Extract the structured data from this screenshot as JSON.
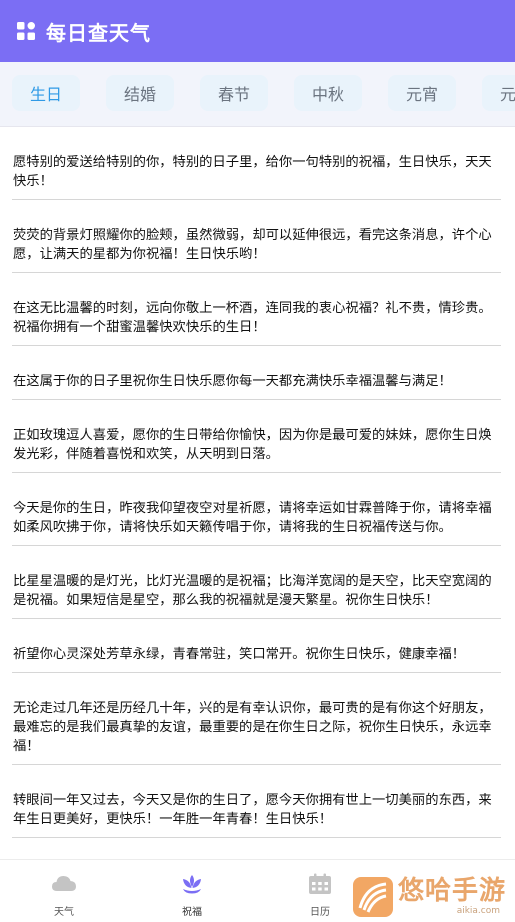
{
  "header": {
    "title": "每日查天气",
    "icon": "grid-icon"
  },
  "tabs": [
    {
      "label": "生日",
      "active": true
    },
    {
      "label": "结婚",
      "active": false
    },
    {
      "label": "春节",
      "active": false
    },
    {
      "label": "中秋",
      "active": false
    },
    {
      "label": "元宵",
      "active": false
    },
    {
      "label": "元旦",
      "active": false
    }
  ],
  "messages": [
    "愿特别的爱送给特别的你，特别的日子里，给你一句特别的祝福，生日快乐，天天快乐！",
    "荧荧的背景灯照耀你的脸颊，虽然微弱，却可以延伸很远，看完这条消息，许个心愿，让满天的星都为你祝福！生日快乐哟！",
    "在这无比温馨的时刻，远向你敬上一杯酒，连同我的衷心祝福？礼不贵，情珍贵。祝福你拥有一个甜蜜温馨快欢快乐的生日！",
    "在这属于你的日子里祝你生日快乐愿你每一天都充满快乐幸福温馨与满足！",
    "正如玫瑰逗人喜爱，愿你的生日带给你愉快，因为你是最可爱的妹妹，愿你生日焕发光彩，伴随着喜悦和欢笑，从天明到日落。",
    "今天是你的生日，昨夜我仰望夜空对星祈愿，请将幸运如甘霖普降于你，请将幸福如柔风吹拂于你，请将快乐如天籁传唱于你，请将我的生日祝福传送与你。",
    "比星星温暖的是灯光，比灯光温暖的是祝福；比海洋宽阔的是天空，比天空宽阔的是祝福。如果短信是星空，那么我的祝福就是漫天繁星。祝你生日快乐！",
    "祈望你心灵深处芳草永绿，青春常驻，笑口常开。祝你生日快乐，健康幸福！",
    "无论走过几年还是历经几十年，兴的是有幸认识你，最可贵的是有你这个好朋友，最难忘的是我们最真挚的友谊，最重要的是在你生日之际，祝你生日快乐，永远幸福！",
    "转眼间一年又过去，今天又是你的生日了，愿今天你拥有世上一切美丽的东西，来年生日更美好，更快乐！一年胜一年青春！生日快乐！"
  ],
  "nav": {
    "weather": {
      "label": "天气",
      "icon": "cloud-icon"
    },
    "blessing": {
      "label": "祝福",
      "icon": "lotus-icon"
    },
    "calendar": {
      "label": "日历",
      "icon": "calendar-icon"
    }
  },
  "watermark": {
    "main": "悠哈手游",
    "sub": "aikia.com"
  },
  "colors": {
    "header": "#7b6ef4",
    "tab_active": "#2f9ae6",
    "nav_active": "#7b6ef4",
    "nav_inactive": "#bfbfbf"
  }
}
